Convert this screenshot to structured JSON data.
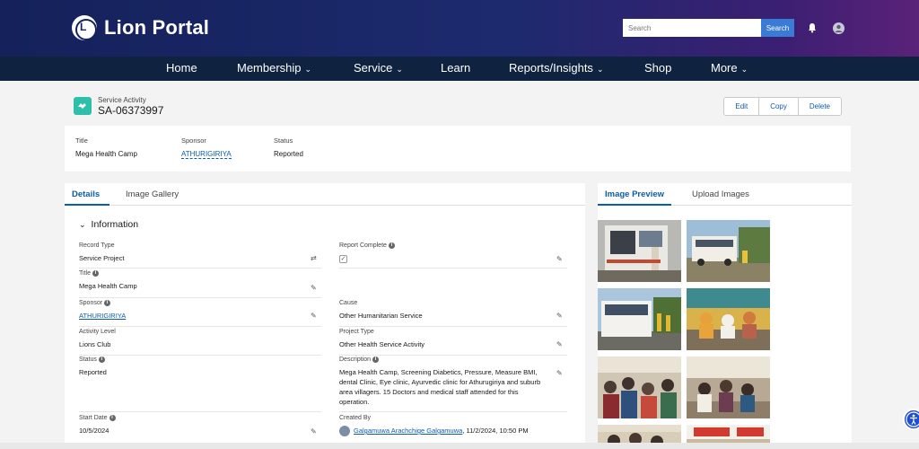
{
  "header": {
    "brand": "Lion Portal",
    "search_placeholder": "Search",
    "search_button": "Search"
  },
  "nav": {
    "items": [
      {
        "label": "Home",
        "dropdown": false
      },
      {
        "label": "Membership",
        "dropdown": true
      },
      {
        "label": "Service",
        "dropdown": true
      },
      {
        "label": "Learn",
        "dropdown": false
      },
      {
        "label": "Reports/Insights",
        "dropdown": true
      },
      {
        "label": "Shop",
        "dropdown": false
      },
      {
        "label": "More",
        "dropdown": true
      }
    ]
  },
  "record": {
    "type": "Service Activity",
    "id": "SA-06373997",
    "actions": [
      "Edit",
      "Copy",
      "Delete"
    ]
  },
  "highlights": {
    "title_label": "Title",
    "title_value": "Mega Health Camp",
    "sponsor_label": "Sponsor",
    "sponsor_value": "ATHURIGIRIYA",
    "status_label": "Status",
    "status_value": "Reported"
  },
  "left_tabs": [
    "Details",
    "Image Gallery"
  ],
  "section": "Information",
  "fields": {
    "record_type": {
      "label": "Record Type",
      "value": "Service Project"
    },
    "report_complete": {
      "label": "Report Complete",
      "checked": true
    },
    "title": {
      "label": "Title",
      "value": "Mega Health Camp"
    },
    "sponsor": {
      "label": "Sponsor",
      "value": "ATHURIGIRIYA"
    },
    "cause": {
      "label": "Cause",
      "value": "Other Humanitarian Service"
    },
    "activity_level": {
      "label": "Activity Level",
      "value": "Lions Club"
    },
    "project_type": {
      "label": "Project Type",
      "value": "Other Health Service Activity"
    },
    "status": {
      "label": "Status",
      "value": "Reported"
    },
    "description": {
      "label": "Description",
      "value": "Mega Health Camp, Screening Diabetics, Pressure, Measure BMI, dental Clinic, Eye clinic, Ayurvedic clinic for Athurugiriya and suburb area villagers. 15 Doctors and medical staff attended for this operation."
    },
    "start_date": {
      "label": "Start Date",
      "value": "10/5/2024"
    },
    "created_by": {
      "label": "Created By",
      "name": "Galgamuwa Arachchige Galgamuwa",
      "date": ", 11/2/2024, 10:50 PM"
    }
  },
  "right_tabs": [
    "Image Preview",
    "Upload Images"
  ],
  "colors": {
    "header_start": "#14215a",
    "header_end": "#5a2279",
    "nav": "#0f2240",
    "accent": "#0b5cab",
    "record_icon": "#2ebfaa"
  }
}
